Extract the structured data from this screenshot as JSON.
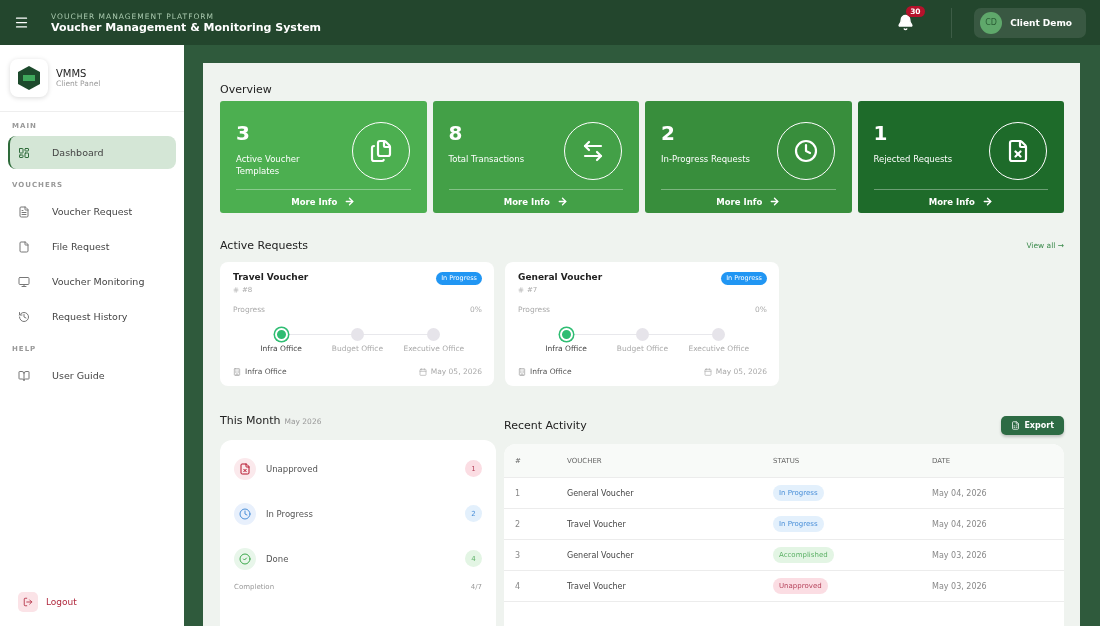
{
  "header": {
    "eyebrow": "VOUCHER MANAGEMENT PLATFORM",
    "title": "Voucher Management & Monitoring System",
    "notifications": "30",
    "user": {
      "initials": "CD",
      "name": "Client Demo"
    }
  },
  "brand": {
    "name": "VMMS",
    "subtitle": "Client Panel"
  },
  "sidebar": {
    "sections": [
      {
        "title": "MAIN",
        "items": [
          {
            "label": "Dashboard",
            "selected": true
          }
        ]
      },
      {
        "title": "VOUCHERS",
        "items": [
          {
            "label": "Voucher Request",
            "selected": false
          },
          {
            "label": "File Request",
            "selected": false
          },
          {
            "label": "Voucher Monitoring",
            "selected": false
          },
          {
            "label": "Request History",
            "selected": false
          }
        ]
      },
      {
        "title": "HELP",
        "items": [
          {
            "label": "User Guide",
            "selected": false
          }
        ]
      }
    ],
    "logout": "Logout"
  },
  "overview": {
    "title": "Overview",
    "cards": [
      {
        "value": "3",
        "label": "Active Voucher Templates",
        "color": "#4caf50",
        "link": "More Info"
      },
      {
        "value": "8",
        "label": "Total Transactions",
        "color": "#43a047",
        "link": "More Info"
      },
      {
        "value": "2",
        "label": "In-Progress Requests",
        "color": "#388e3c",
        "link": "More Info"
      },
      {
        "value": "1",
        "label": "Rejected Requests",
        "color": "#1e6b2a",
        "link": "More Info"
      }
    ]
  },
  "active_requests": {
    "title": "Active Requests",
    "view_all": "View all →",
    "cards": [
      {
        "title": "Travel Voucher",
        "id": "#8",
        "status": "In Progress",
        "progress_label": "Progress",
        "progress": "0%",
        "steps": [
          {
            "label": "Infra Office",
            "active": true
          },
          {
            "label": "Budget Office",
            "active": false
          },
          {
            "label": "Executive Office",
            "active": false
          }
        ],
        "office": "Infra Office",
        "date": "May 05, 2026"
      },
      {
        "title": "General Voucher",
        "id": "#7",
        "status": "In Progress",
        "progress_label": "Progress",
        "progress": "0%",
        "steps": [
          {
            "label": "Infra Office",
            "active": true
          },
          {
            "label": "Budget Office",
            "active": false
          },
          {
            "label": "Executive Office",
            "active": false
          }
        ],
        "office": "Infra Office",
        "date": "May 05, 2026"
      }
    ]
  },
  "this_month": {
    "title": "This Month",
    "period": "May 2026",
    "items": [
      {
        "kind": "unapproved",
        "label": "Unapproved",
        "count": "1"
      },
      {
        "kind": "progress",
        "label": "In Progress",
        "count": "2"
      },
      {
        "kind": "done",
        "label": "Done",
        "count": "4"
      }
    ],
    "completion_label": "Completion",
    "completion": "4/7"
  },
  "recent_activity": {
    "title": "Recent Activity",
    "export": "Export",
    "columns": [
      "#",
      "VOUCHER",
      "STATUS",
      "DATE"
    ],
    "rows": [
      {
        "index": "1",
        "voucher": "General Voucher",
        "status": "In Progress",
        "kind": "progress",
        "date": "May 04, 2026"
      },
      {
        "index": "2",
        "voucher": "Travel Voucher",
        "status": "In Progress",
        "kind": "progress",
        "date": "May 04, 2026"
      },
      {
        "index": "3",
        "voucher": "General Voucher",
        "status": "Accomplished",
        "kind": "accomplished",
        "date": "May 03, 2026"
      },
      {
        "index": "4",
        "voucher": "Travel Voucher",
        "status": "Unapproved",
        "kind": "unapproved",
        "date": "May 03, 2026"
      }
    ]
  }
}
